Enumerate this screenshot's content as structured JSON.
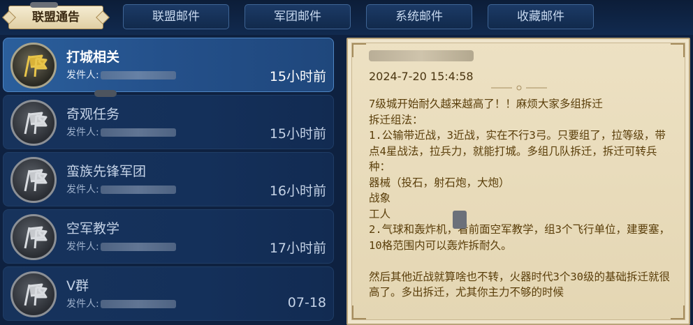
{
  "tabs": [
    {
      "label": "联盟通告",
      "active": true
    },
    {
      "label": "联盟邮件",
      "active": false
    },
    {
      "label": "军团邮件",
      "active": false
    },
    {
      "label": "系统邮件",
      "active": false
    },
    {
      "label": "收藏邮件",
      "active": false
    }
  ],
  "mails": [
    {
      "title": "打城相关",
      "sender_label": "发件人:",
      "time": "15小时前",
      "selected": true
    },
    {
      "title": "奇观任务",
      "sender_label": "发件人:",
      "time": "15小时前",
      "selected": false
    },
    {
      "title": "蛮族先锋军团",
      "sender_label": "发件人:",
      "time": "16小时前",
      "selected": false
    },
    {
      "title": "空军教学",
      "sender_label": "发件人:",
      "time": "17小时前",
      "selected": false
    },
    {
      "title": "V群",
      "sender_label": "发件人:",
      "time": "07-18",
      "selected": false
    }
  ],
  "letter": {
    "date": "2024-7-20 15:4:58",
    "body": "7级城开始耐久越来越高了！！麻烦大家多组拆迁\n拆迁组法：\n1.公输带近战，3近战，实在不行3弓。只要组了，拉等级，带点4星战法，拉兵力，就能打城。多组几队拆迁，拆迁可转兵种：\n器械（投石，射石炮，大炮）\n战象\n工人\n2.气球和轰炸机，看前面空军教学，组3个飞行单位，建要塞，10格范围内可以轰炸拆耐久。\n\n然后其他近战就算啥也不转，火器时代3个30级的基础拆迁就很高了。多出拆迁，尤其你主力不够的时候"
  },
  "colors": {
    "accent_selected": "#2b5f9c",
    "letter_text": "#5a3e0a",
    "parchment": "#ede1c3"
  },
  "icons": {
    "mail_icon": "flag-icon"
  }
}
